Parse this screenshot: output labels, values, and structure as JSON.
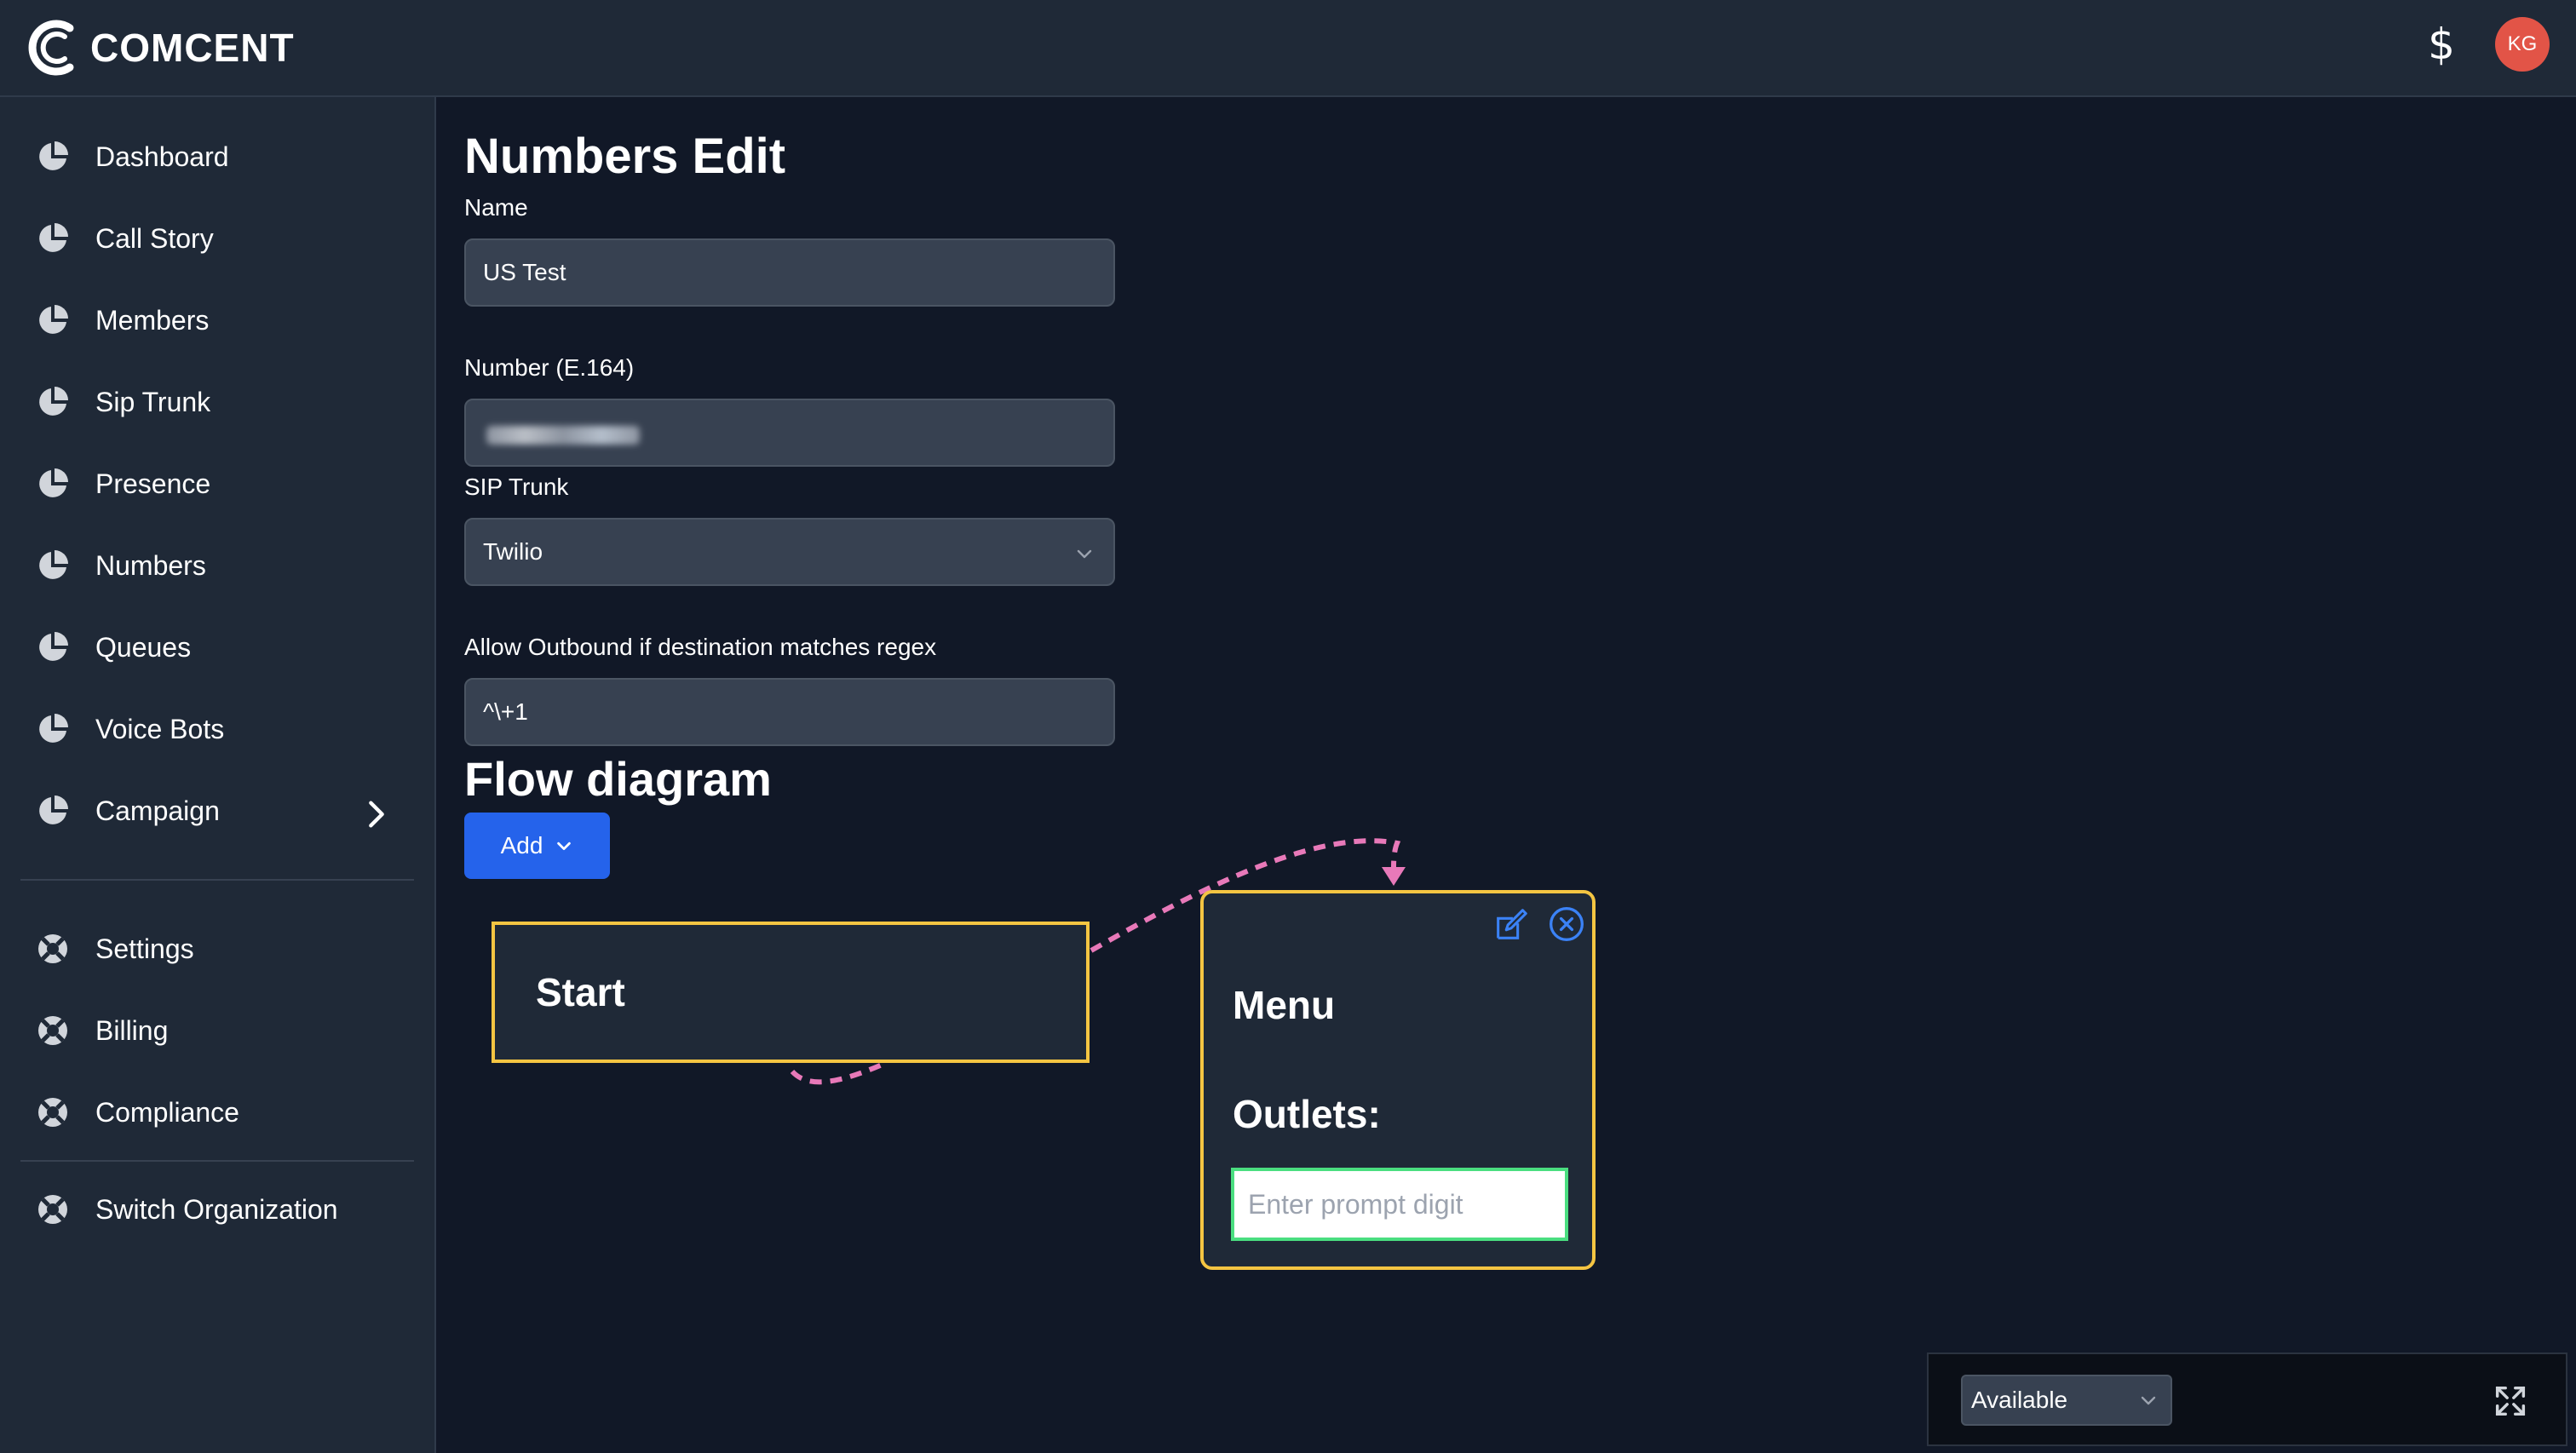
{
  "header": {
    "brand": "COMCENT",
    "currency_icon": "dollar-icon",
    "currency_symbol": "$",
    "avatar_initials": "KG",
    "avatar_color": "#e25447"
  },
  "sidebar": {
    "items": [
      {
        "label": "Dashboard",
        "icon": "pie-chart-icon"
      },
      {
        "label": "Call Story",
        "icon": "pie-chart-icon"
      },
      {
        "label": "Members",
        "icon": "pie-chart-icon"
      },
      {
        "label": "Sip Trunk",
        "icon": "pie-chart-icon"
      },
      {
        "label": "Presence",
        "icon": "pie-chart-icon"
      },
      {
        "label": "Numbers",
        "icon": "pie-chart-icon"
      },
      {
        "label": "Queues",
        "icon": "pie-chart-icon"
      },
      {
        "label": "Voice Bots",
        "icon": "pie-chart-icon"
      },
      {
        "label": "Campaign",
        "icon": "pie-chart-icon"
      }
    ],
    "secondary": [
      {
        "label": "Settings",
        "icon": "lifebuoy-icon"
      },
      {
        "label": "Billing",
        "icon": "lifebuoy-icon"
      },
      {
        "label": "Compliance",
        "icon": "lifebuoy-icon"
      }
    ],
    "footer": [
      {
        "label": "Switch Organization",
        "icon": "lifebuoy-icon"
      }
    ]
  },
  "main": {
    "title": "Numbers Edit",
    "fields": {
      "name": {
        "label": "Name",
        "value": "US Test"
      },
      "number": {
        "label": "Number (E.164)",
        "value": ""
      },
      "sip_trunk": {
        "label": "SIP Trunk",
        "value": "Twilio"
      },
      "outbound_regex": {
        "label": "Allow Outbound if destination matches regex",
        "value": "^\\+1"
      }
    },
    "flow": {
      "title": "Flow diagram",
      "add_label": "Add",
      "nodes": {
        "start": {
          "title": "Start"
        },
        "menu": {
          "title": "Menu",
          "outlets_label": "Outlets:",
          "prompt_placeholder": "Enter prompt digit"
        }
      },
      "node_border_color": "#f5c542",
      "edge_color": "#e879b9"
    }
  },
  "status": {
    "value": "Available"
  },
  "colors": {
    "accent": "#2563eb",
    "background": "#111827",
    "panel": "#1f2937"
  }
}
